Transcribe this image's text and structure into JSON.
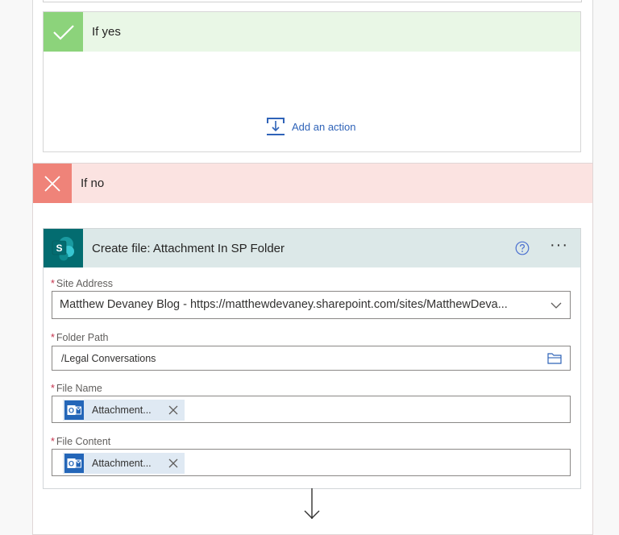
{
  "branch_yes": {
    "title": "If yes",
    "add_action_label": "Add an action"
  },
  "branch_no": {
    "title": "If no"
  },
  "action_card": {
    "title": "Create file: Attachment In SP Folder",
    "logo_letter": "S",
    "fields": {
      "site_address": {
        "label": "Site Address",
        "value": "Matthew Devaney Blog - https://matthewdevaney.sharepoint.com/sites/MatthewDeva..."
      },
      "folder_path": {
        "label": "Folder Path",
        "value": "/Legal Conversations"
      },
      "file_name": {
        "label": "File Name",
        "token": "Attachment..."
      },
      "file_content": {
        "label": "File Content",
        "token": "Attachment..."
      }
    },
    "required_marker": "*"
  },
  "colors": {
    "yes_accent": "#8cd37b",
    "no_accent": "#ef8379",
    "sharepoint": "#036c70",
    "link": "#2f63b8",
    "token_bg": "#dfe9f3",
    "outlook_blue": "#2466b8"
  }
}
